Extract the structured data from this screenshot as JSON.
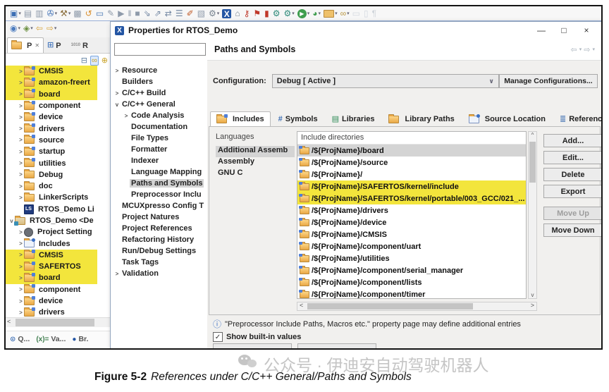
{
  "glyphs": {
    "minimize": "—",
    "maximize": "□",
    "close": "×",
    "tab_close": "✕",
    "back": "⇦",
    "forward": "⇨",
    "caret": "▾",
    "dropdown": "∨",
    "up": "^",
    "down": "v",
    "left": "<",
    "right": ">",
    "check": "✓",
    "info": "ⓘ"
  },
  "toolbar_row1": [
    {
      "name": "new-wizard-icon",
      "glyph": "▣",
      "color": "#3c6eb4",
      "dd": "▾"
    },
    {
      "name": "save-icon",
      "glyph": "▤",
      "color": "#8e9aaa"
    },
    {
      "name": "save-all-icon",
      "glyph": "▥",
      "color": "#8e9aaa"
    },
    {
      "name": "new-c-project-icon",
      "glyph": "✇",
      "color": "#3c6eb4",
      "dd": "▾"
    },
    {
      "name": "build-icon",
      "glyph": "⚒",
      "color": "#8a6d3b",
      "dd": "▾"
    },
    {
      "name": "build-all-icon",
      "glyph": "▩",
      "color": "#8e9aaa"
    },
    {
      "name": "refresh-icon",
      "glyph": "↺",
      "color": "#d98e2b"
    },
    {
      "name": "terminal-icon",
      "glyph": "▭",
      "color": "#4a78b5"
    },
    {
      "name": "annotation-icon",
      "glyph": "✎",
      "color": "#8e9aaa"
    },
    {
      "name": "run-icon",
      "glyph": "▶",
      "color": "#8e9aaa"
    },
    {
      "name": "pause-icon",
      "glyph": "‖",
      "color": "#8e9aaa"
    },
    {
      "name": "stop-icon",
      "glyph": "■",
      "color": "#8e9aaa"
    },
    {
      "name": "step-into-icon",
      "glyph": "⇘",
      "color": "#7488a3"
    },
    {
      "name": "step-over-icon",
      "glyph": "⇗",
      "color": "#7488a3"
    },
    {
      "name": "step-return-icon",
      "glyph": "⇄",
      "color": "#7488a3"
    },
    {
      "name": "outline-icon",
      "glyph": "☰",
      "color": "#7488a3"
    },
    {
      "name": "flash-icon",
      "glyph": "✐",
      "color": "#c05c2a"
    },
    {
      "name": "perspective-icon",
      "glyph": "▧",
      "color": "#8e9aaa"
    },
    {
      "name": "debug-perspective-icon",
      "glyph": "⚙",
      "color": "#77838f",
      "dd": "▾"
    },
    {
      "name": "mcuxpresso-icon",
      "glyph": "X",
      "cls": "xbadge"
    },
    {
      "name": "home-icon",
      "glyph": "⌂",
      "color": "#77838f"
    },
    {
      "name": "key-icon",
      "glyph": "⚷",
      "color": "#c0392b"
    },
    {
      "name": "flag-icon",
      "glyph": "⚑",
      "color": "#c0392b"
    },
    {
      "name": "breakpoint-icon",
      "glyph": "▮",
      "color": "#c0392b"
    },
    {
      "name": "settings-gear-icon",
      "glyph": "⚙",
      "color": "#2e8b7a"
    },
    {
      "name": "settings-gear2-icon",
      "glyph": "⚙",
      "color": "#2e8b7a",
      "dd": "▾"
    },
    {
      "name": "run-app-icon",
      "glyph": "▶",
      "cls": "greenrun",
      "dd": "▾"
    },
    {
      "name": "quick-run-icon",
      "glyph": "◕",
      "color": "#3f9d4e",
      "dd": "▾"
    },
    {
      "name": "open-folder-icon",
      "cls": "mff",
      "dd": "▾"
    },
    {
      "name": "link-tool-icon",
      "glyph": "∞",
      "color": "#b8953f",
      "dd": "▾"
    },
    {
      "name": "ghost-window-icon",
      "glyph": "▭",
      "color": "#d3d8de"
    },
    {
      "name": "ghost-doc-icon",
      "glyph": "▯",
      "color": "#d3d8de"
    },
    {
      "name": "pilcrow-icon",
      "glyph": "¶",
      "color": "#cfd4da"
    }
  ],
  "toolbar_row2": [
    {
      "name": "run-config-icon",
      "glyph": "◉",
      "color": "#4b7bbf",
      "dd": "▾"
    },
    {
      "name": "external-tools-icon",
      "glyph": "◈",
      "color": "#6a8f3f",
      "dd": "▾"
    },
    {
      "name": "back-history-icon",
      "glyph": "⇦",
      "color": "#d8a43c"
    },
    {
      "name": "forward-history-icon",
      "glyph": "⇨",
      "color": "#d8a43c",
      "dd": "▾"
    }
  ],
  "explorer": {
    "tabs": [
      {
        "label": "P",
        "icon_cls": "mf",
        "active": true,
        "close": "✕"
      },
      {
        "label": "P",
        "icon_glyph": "⊞",
        "icon_color": "#4b7bbf"
      },
      {
        "label": "R",
        "icon_glyph": "1010",
        "icon_cls": "bin"
      }
    ],
    "view_icons": [
      {
        "name": "collapse-all-icon",
        "glyph": "⊟",
        "color": "#5b7c9e"
      },
      {
        "name": "link-editor-icon",
        "glyph": "∞",
        "color": "#c9a227",
        "cls": "selbox"
      },
      {
        "name": "view-menu-icon",
        "glyph": "⊕",
        "color": "#c9a227"
      }
    ],
    "tree": [
      {
        "exp": ">",
        "icon": "src-folder",
        "label": "CMSIS",
        "hl": true,
        "ind": 1
      },
      {
        "exp": ">",
        "icon": "src-folder",
        "label": "amazon-freert",
        "hl": true,
        "ind": 1
      },
      {
        "exp": ">",
        "icon": "src-folder",
        "label": "board",
        "hl": true,
        "ind": 1
      },
      {
        "exp": ">",
        "icon": "src-folder",
        "label": "component",
        "ind": 1
      },
      {
        "exp": ">",
        "icon": "src-folder",
        "label": "device",
        "ind": 1
      },
      {
        "exp": ">",
        "icon": "src-folder",
        "label": "drivers",
        "ind": 1
      },
      {
        "exp": ">",
        "icon": "src-folder",
        "label": "source",
        "ind": 1
      },
      {
        "exp": ">",
        "icon": "src-folder",
        "label": "startup",
        "ind": 1
      },
      {
        "exp": ">",
        "icon": "src-folder",
        "label": "utilities",
        "ind": 1
      },
      {
        "exp": ">",
        "icon": "folder",
        "label": "Debug",
        "ind": 1
      },
      {
        "exp": ">",
        "icon": "folder",
        "label": "doc",
        "ind": 1
      },
      {
        "exp": ">",
        "icon": "folder",
        "label": "LinkerScripts",
        "ind": 1
      },
      {
        "icon": "ls-file",
        "label": "RTOS_Demo Li",
        "ind": 1
      },
      {
        "exp": "v",
        "icon": "project",
        "label": "RTOS_Demo <De",
        "ind": 0
      },
      {
        "exp": ">",
        "icon": "settings",
        "label": "Project Setting",
        "ind": 1
      },
      {
        "exp": ">",
        "icon": "includes",
        "label": "Includes",
        "ind": 1
      },
      {
        "exp": ">",
        "icon": "src-folder",
        "label": "CMSIS",
        "hl": true,
        "ind": 1
      },
      {
        "exp": ">",
        "icon": "src-folder",
        "label": "SAFERTOS",
        "hl": true,
        "ind": 1
      },
      {
        "exp": ">",
        "icon": "src-folder",
        "label": "board",
        "hl": true,
        "ind": 1
      },
      {
        "exp": ">",
        "icon": "src-folder",
        "label": "component",
        "ind": 1
      },
      {
        "exp": ">",
        "icon": "src-folder",
        "label": "device",
        "ind": 1
      },
      {
        "exp": ">",
        "icon": "src-folder",
        "label": "drivers",
        "ind": 1
      }
    ],
    "bottom_tabs": [
      {
        "name": "quickstart-tab",
        "glyph": "⊙",
        "color": "#3c6eb4",
        "label": "Q..."
      },
      {
        "name": "variables-tab",
        "glyph": "(x)=",
        "color": "#3f7d4e",
        "label": "Va..."
      },
      {
        "name": "breakpoints-tab",
        "glyph": "●",
        "color": "#2456a4",
        "label": "Br."
      }
    ]
  },
  "dialog": {
    "title": "Properties for RTOS_Demo",
    "icon_glyph": "X",
    "filter_value": "",
    "nav_tree": [
      {
        "exp": ">",
        "label": "Resource",
        "ind": 0
      },
      {
        "label": "Builders",
        "ind": 0
      },
      {
        "exp": ">",
        "label": "C/C++ Build",
        "ind": 0
      },
      {
        "exp": "v",
        "label": "C/C++ General",
        "ind": 0
      },
      {
        "exp": ">",
        "label": "Code Analysis",
        "ind": 1
      },
      {
        "label": "Documentation",
        "ind": 1
      },
      {
        "label": "File Types",
        "ind": 1
      },
      {
        "label": "Formatter",
        "ind": 1
      },
      {
        "label": "Indexer",
        "ind": 1
      },
      {
        "label": "Language Mapping",
        "ind": 1
      },
      {
        "label": "Paths and Symbols",
        "ind": 1,
        "selected": true
      },
      {
        "label": "Preprocessor Inclu",
        "ind": 1
      },
      {
        "label": "MCUXpresso Config T",
        "ind": 0
      },
      {
        "label": "Project Natures",
        "ind": 0
      },
      {
        "label": "Project References",
        "ind": 0
      },
      {
        "label": "Refactoring History",
        "ind": 0
      },
      {
        "label": "Run/Debug Settings",
        "ind": 0
      },
      {
        "label": "Task Tags",
        "ind": 0
      },
      {
        "exp": ">",
        "label": "Validation",
        "ind": 0
      }
    ],
    "header": "Paths and Symbols",
    "config_label": "Configuration:",
    "config_value": "Debug  [ Active ]",
    "manage_btn": "Manage Configurations...",
    "tabs": [
      {
        "label": "Includes",
        "icon_cls": "mf ic-src-folder",
        "active": true
      },
      {
        "label": "Symbols",
        "icon_glyph": "#",
        "icon_color": "#3c6eb4"
      },
      {
        "label": "Libraries",
        "icon_glyph": "▤",
        "icon_color": "#2e8b57"
      },
      {
        "label": "Library Paths",
        "icon_cls": "mf"
      },
      {
        "label": "Source Location",
        "icon_cls": "mf ic-includes"
      },
      {
        "label": "References",
        "icon_glyph": "≣",
        "icon_color": "#4a78b5"
      }
    ],
    "languages": {
      "header": "Languages",
      "items": [
        {
          "label": "Additional Assemb",
          "selected": true
        },
        {
          "label": "Assembly"
        },
        {
          "label": "GNU C"
        }
      ]
    },
    "includes": {
      "header": "Include directories",
      "rows": [
        {
          "path": "/${ProjName}/board",
          "selected": true
        },
        {
          "path": "/${ProjName}/source"
        },
        {
          "path": "/${ProjName}/"
        },
        {
          "path": "/${ProjName}/SAFERTOS/kernel/include",
          "hl": true
        },
        {
          "path": "/${ProjName}/SAFERTOS/kernel/portable/003_GCC/021_...",
          "hl": true
        },
        {
          "path": "/${ProjName}/drivers"
        },
        {
          "path": "/${ProjName}/device"
        },
        {
          "path": "/${ProjName}/CMSIS"
        },
        {
          "path": "/${ProjName}/component/uart"
        },
        {
          "path": "/${ProjName}/utilities"
        },
        {
          "path": "/${ProjName}/component/serial_manager"
        },
        {
          "path": "/${ProjName}/component/lists"
        },
        {
          "path": "/${ProjName}/component/timer"
        }
      ]
    },
    "buttons": [
      {
        "label": "Add..."
      },
      {
        "label": "Edit..."
      },
      {
        "label": "Delete"
      },
      {
        "label": "Export"
      },
      {
        "label": "Move Up",
        "disabled": true,
        "gap": true
      },
      {
        "label": "Move Down"
      }
    ],
    "info": "\"Preprocessor Include Paths, Macros etc.\" property page may define additional entries",
    "checkbox_label": "Show built-in values"
  },
  "caption": {
    "prefix": "Figure 5-2",
    "text": "References under C/C++ General/Paths and Symbols"
  },
  "watermark": {
    "text": "公众号 · 伊迪安自动驾驶机器人"
  }
}
